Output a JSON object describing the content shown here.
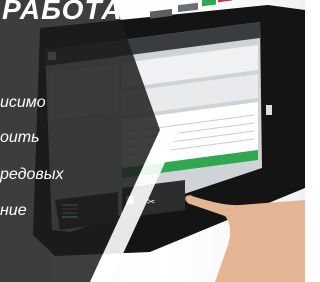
{
  "banner": {
    "title": "РАБОТА"
  },
  "caption_lines": [
    "исимо",
    "оить",
    "редовых",
    "ние"
  ],
  "colors": {
    "dark_band": "#1c1c1c",
    "green_bar": "#2fa84f",
    "tablet_frame": "#161616"
  },
  "icons": [
    "home-icon",
    "printer-icon",
    "scissors-icon",
    "pointing-hand"
  ]
}
